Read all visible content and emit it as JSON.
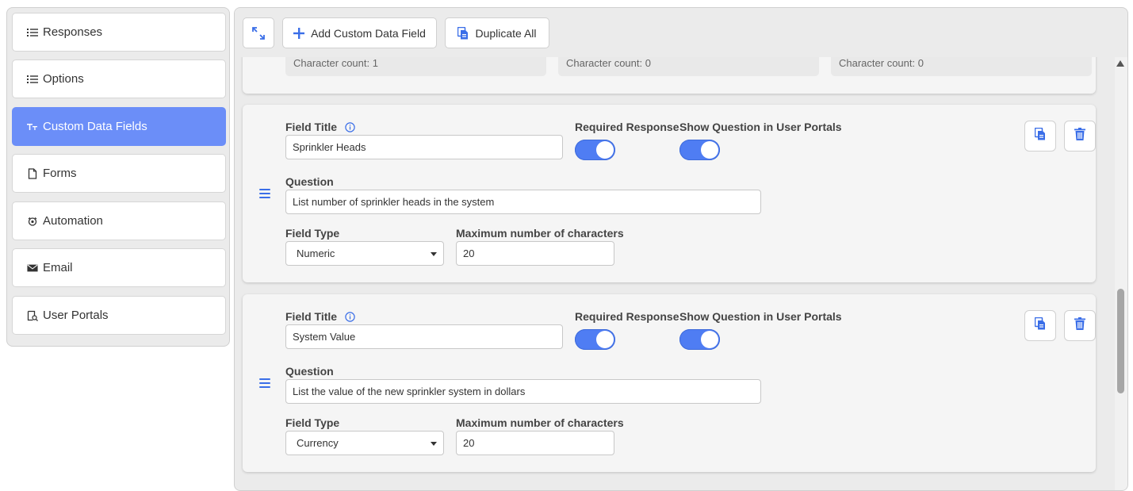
{
  "sidebar": {
    "items": [
      {
        "label": "Responses",
        "icon": "list-icon",
        "active": false
      },
      {
        "label": "Options",
        "icon": "list-icon",
        "active": false
      },
      {
        "label": "Custom Data Fields",
        "icon": "text-format-icon",
        "active": true
      },
      {
        "label": "Forms",
        "icon": "document-icon",
        "active": false
      },
      {
        "label": "Automation",
        "icon": "automation-icon",
        "active": false
      },
      {
        "label": "Email",
        "icon": "envelope-icon",
        "active": false
      },
      {
        "label": "User Portals",
        "icon": "portal-icon",
        "active": false
      }
    ]
  },
  "toolbar": {
    "expand_icon": "expand-icon",
    "add_label": "Add Custom Data Field",
    "duplicate_label": "Duplicate All"
  },
  "partial": {
    "counts": [
      "Character count: 1",
      "Character count: 0",
      "Character count: 0"
    ]
  },
  "fields": [
    {
      "title_label": "Field Title",
      "title_value": "Sprinkler Heads",
      "required_label": "Required Response",
      "required_on": true,
      "portal_label": "Show Question in User Portals",
      "portal_on": true,
      "question_label": "Question",
      "question_value": "List number of sprinkler heads in the system",
      "type_label": "Field Type",
      "type_value": "Numeric",
      "max_label": "Maximum number of characters",
      "max_value": "20"
    },
    {
      "title_label": "Field Title",
      "title_value": "System Value",
      "required_label": "Required Response",
      "required_on": true,
      "portal_label": "Show Question in User Portals",
      "portal_on": true,
      "question_label": "Question",
      "question_value": "List the value of the new sprinkler system in dollars",
      "type_label": "Field Type",
      "type_value": "Currency",
      "max_label": "Maximum number of characters",
      "max_value": "20"
    }
  ],
  "colors": {
    "accent": "#4f7df3",
    "active_nav": "#6b8ef8",
    "icon_blue": "#3a6ee8"
  }
}
